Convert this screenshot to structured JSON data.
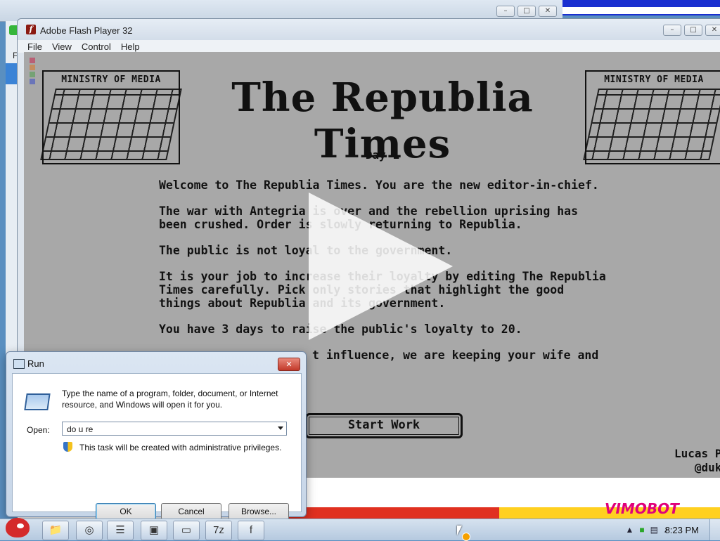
{
  "flash_player": {
    "title": "Adobe Flash Player 32",
    "menu": [
      "File",
      "View",
      "Control",
      "Help"
    ],
    "window_controls": [
      "–",
      "□",
      "✕"
    ]
  },
  "game": {
    "seal_label": "MINISTRY OF MEDIA",
    "newspaper_title": "The Republia Times",
    "day": "Day 1",
    "paragraphs": [
      "Welcome to The Republia Times. You are the new editor-in-chief.",
      "The war with Antegria is over and the rebellion uprising has been crushed. Order is slowly returning to Republia.",
      "The public is not loyal to the government.",
      "It is your job to increase their loyalty by editing The Republia Times carefully. Pick only stories that highlight the good things about Republia and its government.",
      "You have 3 days to raise the public's loyalty to 20.",
      "t influence, we are keeping your wife and"
    ],
    "start_button": "Start Work",
    "credit_line1": "Lucas Po",
    "credit_line2": "@duko"
  },
  "run_dialog": {
    "title": "Run",
    "close_glyph": "✕",
    "description": "Type the name of a program, folder, document, or Internet resource, and Windows will open it for you.",
    "open_label": "Open:",
    "open_value": "do u re",
    "admin_note": "This task will be created with administrative privileges.",
    "ok_label": "OK",
    "cancel_label": "Cancel",
    "browse_label": "Browse..."
  },
  "background": {
    "side_letter": "F",
    "cartoon_text": "VIMOBOT"
  },
  "taskbar": {
    "items": [
      "explorer-icon",
      "chrome-icon",
      "notepad-icon",
      "media-icon",
      "run-icon",
      "7zip-icon",
      "flash-icon"
    ],
    "item_glyphs": [
      "📁",
      "◎",
      "☰",
      "▣",
      "▭",
      "7z",
      "f"
    ],
    "tray_glyphs": [
      "▲",
      "■",
      "▤",
      "♪"
    ],
    "clock": "8:23 PM"
  }
}
